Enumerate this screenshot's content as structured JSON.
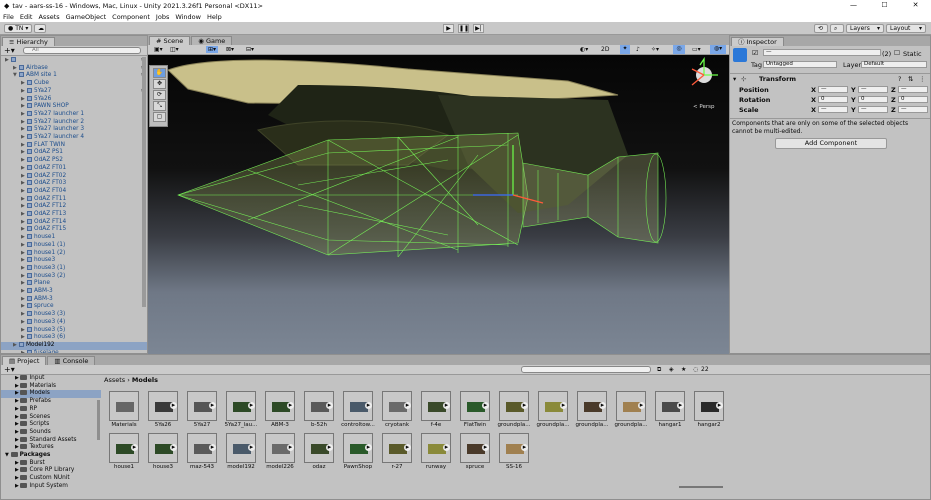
{
  "window": {
    "title": "tav - aars-ss-16 - Windows, Mac, Linux - Unity 2021.3.26f1 Personal <DX11>",
    "minimize": "—",
    "maximize": "☐",
    "close": "✕"
  },
  "menu": [
    "File",
    "Edit",
    "Assets",
    "GameObject",
    "Component",
    "Jobs",
    "Window",
    "Help"
  ],
  "toolbar": {
    "account": "TN",
    "layers": "Layers",
    "layout": "Layout"
  },
  "hierarchy": {
    "tab": "Hierarchy",
    "search_placeholder": "All",
    "items": [
      {
        "label": "",
        "indent": 0
      },
      {
        "label": "Airbase",
        "indent": 1
      },
      {
        "label": "ABM site 1",
        "indent": 1,
        "open": true
      },
      {
        "label": "Cube",
        "indent": 2
      },
      {
        "label": "5Ya27",
        "indent": 2
      },
      {
        "label": "5Ya26",
        "indent": 2
      },
      {
        "label": "PAWN SHOP",
        "indent": 2
      },
      {
        "label": "5Ya27 launcher 1",
        "indent": 2
      },
      {
        "label": "5Ya27 launcher 2",
        "indent": 2
      },
      {
        "label": "5Ya27 launcher 3",
        "indent": 2
      },
      {
        "label": "5Ya27 launcher 4",
        "indent": 2
      },
      {
        "label": "FLAT TWIN",
        "indent": 2
      },
      {
        "label": "OdAZ PS1",
        "indent": 2
      },
      {
        "label": "OdAZ PS2",
        "indent": 2
      },
      {
        "label": "OdAZ FT01",
        "indent": 2
      },
      {
        "label": "OdAZ FT02",
        "indent": 2
      },
      {
        "label": "OdAZ FT03",
        "indent": 2
      },
      {
        "label": "OdAZ FT04",
        "indent": 2
      },
      {
        "label": "OdAZ FT11",
        "indent": 2
      },
      {
        "label": "OdAZ FT12",
        "indent": 2
      },
      {
        "label": "OdAZ FT13",
        "indent": 2
      },
      {
        "label": "OdAZ FT14",
        "indent": 2
      },
      {
        "label": "OdAZ FT15",
        "indent": 2
      },
      {
        "label": "house1",
        "indent": 2
      },
      {
        "label": "house1 (1)",
        "indent": 2
      },
      {
        "label": "house1 (2)",
        "indent": 2
      },
      {
        "label": "house3",
        "indent": 2
      },
      {
        "label": "house3 (1)",
        "indent": 2
      },
      {
        "label": "house3 (2)",
        "indent": 2
      },
      {
        "label": "Plane",
        "indent": 2
      },
      {
        "label": "ABM-3",
        "indent": 2
      },
      {
        "label": "ABM-3",
        "indent": 2
      },
      {
        "label": "spruce",
        "indent": 2
      },
      {
        "label": "house3 (3)",
        "indent": 2
      },
      {
        "label": "house3 (4)",
        "indent": 2
      },
      {
        "label": "house3 (5)",
        "indent": 2
      },
      {
        "label": "house3 (6)",
        "indent": 2
      },
      {
        "label": "Model192",
        "indent": 1,
        "selected": true
      },
      {
        "label": "fuselage",
        "indent": 2
      }
    ]
  },
  "scene": {
    "tabs": [
      "Scene",
      "Game"
    ],
    "toggle_2d": "2D",
    "persp": "< Persp"
  },
  "inspector": {
    "tab": "Inspector",
    "count": "(2)",
    "static": "Static",
    "tag_label": "Tag",
    "tag_value": "Untagged",
    "layer_label": "Layer",
    "layer_value": "Default",
    "transform": "Transform",
    "rows": [
      {
        "label": "Position",
        "x": "—",
        "y": "—",
        "z": "—"
      },
      {
        "label": "Rotation",
        "x": "0",
        "y": "0",
        "z": "0"
      },
      {
        "label": "Scale",
        "x": "—",
        "y": "—",
        "z": "—"
      }
    ],
    "note": "Components that are only on some of the selected objects cannot be multi-edited.",
    "add_component": "Add Component"
  },
  "project": {
    "tabs": [
      "Project",
      "Console"
    ],
    "breadcrumb_root": "Assets",
    "breadcrumb_sep": "›",
    "breadcrumb_leaf": "Models",
    "tree": [
      {
        "label": "Input",
        "indent": 1
      },
      {
        "label": "Materials",
        "indent": 1
      },
      {
        "label": "Models",
        "indent": 1,
        "selected": true
      },
      {
        "label": "Prefabs",
        "indent": 1
      },
      {
        "label": "RP",
        "indent": 1
      },
      {
        "label": "Scenes",
        "indent": 1
      },
      {
        "label": "Scripts",
        "indent": 1
      },
      {
        "label": "Sounds",
        "indent": 1
      },
      {
        "label": "Standard Assets",
        "indent": 1
      },
      {
        "label": "Textures",
        "indent": 1
      },
      {
        "label": "Packages",
        "indent": 0
      },
      {
        "label": "Burst",
        "indent": 1
      },
      {
        "label": "Core RP Library",
        "indent": 1
      },
      {
        "label": "Custom NUnit",
        "indent": 1
      },
      {
        "label": "Input System",
        "indent": 1
      }
    ],
    "assets_row1": [
      "Materials",
      "5Ya26",
      "5Ya27",
      "5Ya27_lau...",
      "ABM-3",
      "b-52h",
      "controltow...",
      "cryotank",
      "f-4e",
      "FlatTwin",
      "groundpla...",
      "groundpla...",
      "groundpla...",
      "groundpla...",
      "hangar1",
      "hangar2"
    ],
    "assets_row2": [
      "house1",
      "house3",
      "maz-543",
      "model192",
      "model226",
      "odaz",
      "PawnShop",
      "r-27",
      "runway",
      "spruce",
      "SS-16"
    ],
    "hidden_count": "22"
  },
  "colors": {
    "selection": "#8ca3c4",
    "wire": "#7dff5a",
    "hull": "#c9c08a"
  }
}
